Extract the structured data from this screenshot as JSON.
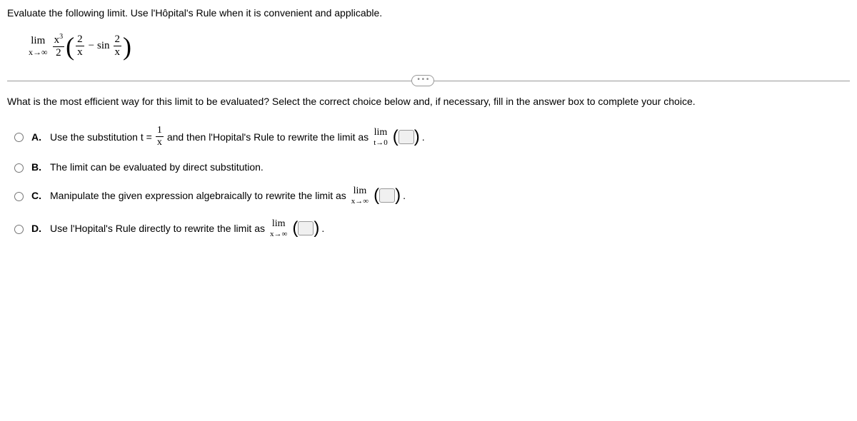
{
  "problem": "Evaluate the following limit. Use l'Hôpital's Rule when it is convenient and applicable.",
  "expr": {
    "lim_label": "lim",
    "lim_approach": "x→∞",
    "fraction_num": "x",
    "fraction_num_sup": "3",
    "fraction_den": "2",
    "inner_frac1_num": "2",
    "inner_frac1_den": "x",
    "minus": "−",
    "sin": "sin",
    "inner_frac2_num": "2",
    "inner_frac2_den": "x"
  },
  "question": "What is the most efficient way for this limit to be evaluated? Select the correct choice below and, if necessary, fill in the answer box to complete your choice.",
  "options": {
    "A": {
      "label": "A.",
      "text1": "Use the substitution t =",
      "frac_num": "1",
      "frac_den": "x",
      "text2": "and then l'Hopital's Rule to rewrite the limit as",
      "lim_label": "lim",
      "lim_approach": "t→0",
      "period": "."
    },
    "B": {
      "label": "B.",
      "text": "The limit can be evaluated by direct substitution."
    },
    "C": {
      "label": "C.",
      "text": "Manipulate the given expression algebraically to rewrite the limit as",
      "lim_label": "lim",
      "lim_approach": "x→∞",
      "period": "."
    },
    "D": {
      "label": "D.",
      "text": "Use l'Hopital's Rule directly to rewrite the limit as",
      "lim_label": "lim",
      "lim_approach": "x→∞",
      "period": "."
    }
  },
  "ellipsis": "• • •"
}
